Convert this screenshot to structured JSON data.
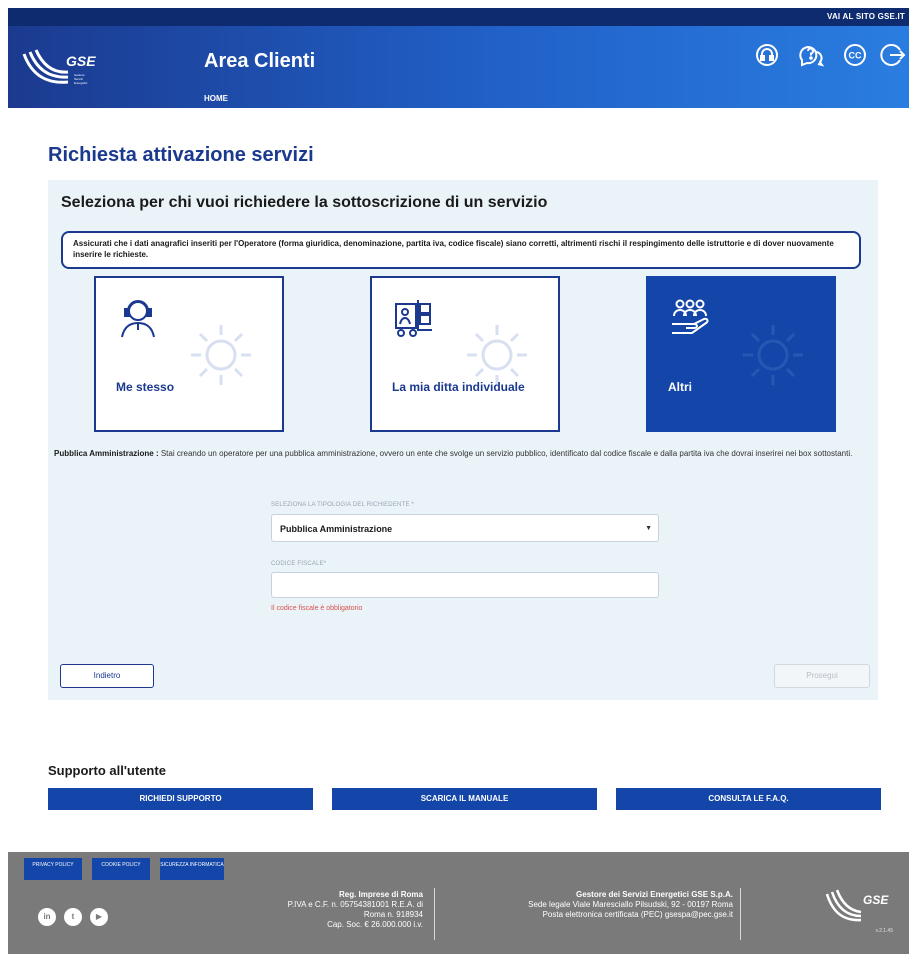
{
  "header": {
    "external_link": "VAI AL SITO GSE.IT",
    "logo_text": "GSE",
    "logo_sub": "Gestore Servizi Energetici",
    "title": "Area Clienti",
    "home": "HOME"
  },
  "main": {
    "title": "Richiesta attivazione servizi",
    "subtitle": "Seleziona per chi vuoi richiedere la sottoscrizione di un servizio",
    "notice": "Assicurati che i dati anagrafici inseriti per l'Operatore (forma giuridica, denominazione, partita iva, codice fiscale) siano corretti, altrimenti rischi il respingimento delle istruttorie e di dover nuovamente inserire le richieste.",
    "cards": [
      {
        "label": "Me stesso",
        "icon": "operator-headset-icon"
      },
      {
        "label": "La mia ditta individuale",
        "icon": "forklift-icon"
      },
      {
        "label": "Altri",
        "icon": "group-hand-icon"
      }
    ],
    "pa_label": "Pubblica Amministrazione :",
    "pa_description": "Stai creando un operatore per una pubblica amministrazione, ovvero un ente che svolge un servizio pubblico, identificato dal codice fiscale e dalla partita iva che dovrai inserirei nei box sottostanti.",
    "select_label": "SELEZIONA LA TIPOLOGIA DEL RICHIEDENTE *",
    "select_value": "Pubblica Amministrazione",
    "cf_label": "CODICE FISCALE*",
    "cf_value": "",
    "cf_error": "Il codice fiscale è obbligatorio",
    "back_label": "Indietro",
    "next_label": "Prosegui"
  },
  "support": {
    "title": "Supporto all'utente",
    "buttons": [
      "RICHIEDI SUPPORTO",
      "SCARICA IL MANUALE",
      "CONSULTA LE F.A.Q."
    ]
  },
  "footer": {
    "links": [
      "PRIVACY POLICY",
      "COOKIE POLICY",
      "SICUREZZA INFORMATICA"
    ],
    "reg_title": "Reg. Imprese di Roma",
    "reg_lines": [
      "P.IVA e C.F. n. 05754381001 R.E.A. di",
      "Roma n. 918934",
      "Cap. Soc. € 26.000.000 i.v."
    ],
    "company": "Gestore dei Servizi Energetici GSE S.p.A.",
    "company_lines": [
      "Sede legale Viale Maresciallo Pilsudski, 92 - 00197 Roma",
      "Posta elettronica certificata (PEC) gsespa@pec.gse.it"
    ],
    "version": "v.2.1.45"
  },
  "colors": {
    "brand_dark": "#0d2b6e",
    "brand": "#1346a8",
    "panel_bg": "#eaf3f8",
    "footer_bg": "#7a7a7a",
    "error": "#d9534f"
  }
}
